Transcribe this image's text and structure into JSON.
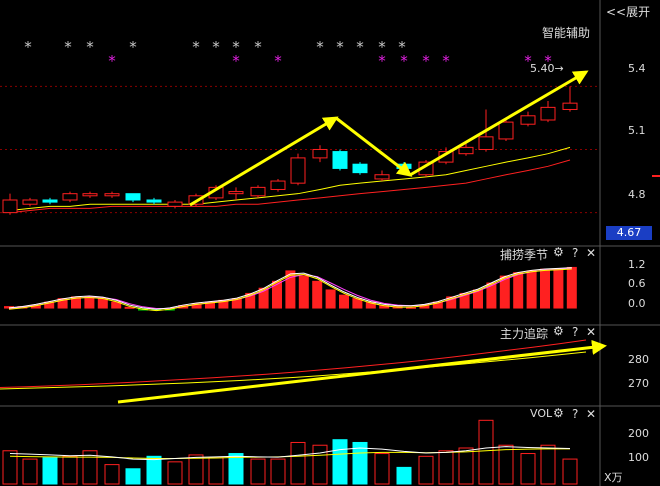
{
  "header": {
    "expand_label": "<<展开",
    "panel_title": "智能辅助"
  },
  "markers": {
    "gray_symbol": "*",
    "magenta_symbol": "*",
    "gray_x": [
      28,
      68,
      90,
      133,
      196,
      216,
      236,
      258,
      320,
      340,
      360,
      382,
      402
    ],
    "magenta_x": [
      112,
      236,
      278,
      382,
      404,
      426,
      446,
      528,
      548
    ]
  },
  "main": {
    "price_tag": "5.40→",
    "current_price": "4.67",
    "axis_labels": [
      "5.4",
      "5.1",
      "4.8"
    ],
    "ylim": [
      4.67,
      5.62
    ],
    "candles": [
      {
        "x": 10,
        "o": 4.86,
        "c": 4.8,
        "h": 4.89,
        "l": 4.79,
        "color": "red-hollow"
      },
      {
        "x": 30,
        "o": 4.84,
        "c": 4.86,
        "h": 4.87,
        "l": 4.83,
        "color": "red-hollow"
      },
      {
        "x": 50,
        "o": 4.85,
        "c": 4.86,
        "h": 4.87,
        "l": 4.84,
        "color": "cyan"
      },
      {
        "x": 70,
        "o": 4.86,
        "c": 4.89,
        "h": 4.9,
        "l": 4.85,
        "color": "red-hollow"
      },
      {
        "x": 90,
        "o": 4.88,
        "c": 4.89,
        "h": 4.9,
        "l": 4.87,
        "color": "red-hollow"
      },
      {
        "x": 112,
        "o": 4.89,
        "c": 4.88,
        "h": 4.9,
        "l": 4.87,
        "color": "red-hollow"
      },
      {
        "x": 133,
        "o": 4.89,
        "c": 4.86,
        "h": 4.89,
        "l": 4.85,
        "color": "cyan"
      },
      {
        "x": 154,
        "o": 4.86,
        "c": 4.85,
        "h": 4.87,
        "l": 4.84,
        "color": "cyan"
      },
      {
        "x": 175,
        "o": 4.83,
        "c": 4.85,
        "h": 4.86,
        "l": 4.82,
        "color": "red-hollow"
      },
      {
        "x": 196,
        "o": 4.84,
        "c": 4.88,
        "h": 4.89,
        "l": 4.83,
        "color": "red-hollow"
      },
      {
        "x": 216,
        "o": 4.87,
        "c": 4.92,
        "h": 4.93,
        "l": 4.86,
        "color": "red-hollow"
      },
      {
        "x": 236,
        "o": 4.9,
        "c": 4.89,
        "h": 4.92,
        "l": 4.86,
        "color": "red-hollow"
      },
      {
        "x": 258,
        "o": 4.88,
        "c": 4.92,
        "h": 4.93,
        "l": 4.87,
        "color": "red-hollow"
      },
      {
        "x": 278,
        "o": 4.91,
        "c": 4.95,
        "h": 4.96,
        "l": 4.9,
        "color": "red-hollow"
      },
      {
        "x": 298,
        "o": 4.94,
        "c": 5.06,
        "h": 5.08,
        "l": 4.93,
        "color": "red-hollow"
      },
      {
        "x": 320,
        "o": 5.06,
        "c": 5.1,
        "h": 5.12,
        "l": 5.04,
        "color": "red-hollow"
      },
      {
        "x": 340,
        "o": 5.09,
        "c": 5.01,
        "h": 5.1,
        "l": 5.0,
        "color": "cyan"
      },
      {
        "x": 360,
        "o": 5.03,
        "c": 4.99,
        "h": 5.04,
        "l": 4.98,
        "color": "cyan"
      },
      {
        "x": 382,
        "o": 4.98,
        "c": 4.96,
        "h": 5.0,
        "l": 4.95,
        "color": "red-hollow"
      },
      {
        "x": 404,
        "o": 5.03,
        "c": 5.01,
        "h": 5.04,
        "l": 5.0,
        "color": "cyan"
      },
      {
        "x": 426,
        "o": 4.98,
        "c": 5.04,
        "h": 5.05,
        "l": 4.97,
        "color": "red-hollow"
      },
      {
        "x": 446,
        "o": 5.04,
        "c": 5.09,
        "h": 5.11,
        "l": 5.03,
        "color": "red-hollow"
      },
      {
        "x": 466,
        "o": 5.08,
        "c": 5.11,
        "h": 5.13,
        "l": 5.07,
        "color": "red-hollow"
      },
      {
        "x": 486,
        "o": 5.1,
        "c": 5.16,
        "h": 5.29,
        "l": 5.09,
        "color": "red-hollow"
      },
      {
        "x": 506,
        "o": 5.15,
        "c": 5.23,
        "h": 5.25,
        "l": 5.14,
        "color": "red-hollow"
      },
      {
        "x": 528,
        "o": 5.22,
        "c": 5.26,
        "h": 5.28,
        "l": 5.21,
        "color": "red-hollow"
      },
      {
        "x": 548,
        "o": 5.24,
        "c": 5.3,
        "h": 5.33,
        "l": 5.23,
        "color": "red-hollow"
      },
      {
        "x": 570,
        "o": 5.29,
        "c": 5.32,
        "h": 5.4,
        "l": 5.28,
        "color": "red-hollow"
      }
    ],
    "ma_yellow": [
      4.81,
      4.82,
      4.83,
      4.83,
      4.84,
      4.84,
      4.84,
      4.84,
      4.84,
      4.84,
      4.85,
      4.86,
      4.87,
      4.88,
      4.89,
      4.91,
      4.93,
      4.94,
      4.95,
      4.96,
      4.97,
      4.98,
      5.0,
      5.02,
      5.04,
      5.06,
      5.08,
      5.11
    ],
    "ma_red": [
      4.8,
      4.81,
      4.82,
      4.82,
      4.82,
      4.83,
      4.83,
      4.83,
      4.83,
      4.83,
      4.83,
      4.84,
      4.84,
      4.85,
      4.86,
      4.87,
      4.88,
      4.89,
      4.9,
      4.91,
      4.92,
      4.93,
      4.94,
      4.96,
      4.98,
      5.0,
      5.02,
      5.05
    ],
    "arrows": [
      {
        "from": [
          190,
          205
        ],
        "to": [
          336,
          118
        ]
      },
      {
        "from": [
          336,
          118
        ],
        "to": [
          410,
          175
        ]
      },
      {
        "from": [
          410,
          175
        ],
        "to": [
          586,
          72
        ]
      }
    ]
  },
  "panel_bull": {
    "title": "捕捞季节",
    "axis_labels": [
      "1.2",
      "0.6",
      "0.0"
    ],
    "ylim": [
      -0.1,
      1.4
    ],
    "bars": [
      0.07,
      0.07,
      0.1,
      0.2,
      0.3,
      0.35,
      0.35,
      0.3,
      0.2,
      0.05,
      0.0,
      -0.05,
      0.0,
      0.1,
      0.15,
      0.2,
      0.25,
      0.3,
      0.45,
      0.6,
      0.8,
      1.1,
      0.95,
      0.8,
      0.55,
      0.4,
      0.3,
      0.2,
      0.1,
      0.07,
      0.05,
      0.1,
      0.2,
      0.35,
      0.45,
      0.55,
      0.75,
      0.95,
      1.05,
      1.1,
      1.15,
      1.15,
      1.2
    ],
    "line_a": [
      0.02,
      0.06,
      0.12,
      0.2,
      0.28,
      0.34,
      0.36,
      0.33,
      0.24,
      0.1,
      0.02,
      -0.02,
      0.02,
      0.1,
      0.16,
      0.2,
      0.24,
      0.3,
      0.42,
      0.58,
      0.8,
      1.0,
      1.02,
      0.9,
      0.68,
      0.48,
      0.32,
      0.2,
      0.12,
      0.08,
      0.08,
      0.12,
      0.2,
      0.32,
      0.44,
      0.56,
      0.74,
      0.92,
      1.04,
      1.1,
      1.14,
      1.16,
      1.18
    ],
    "line_b": [
      0.0,
      0.04,
      0.09,
      0.16,
      0.24,
      0.3,
      0.33,
      0.32,
      0.26,
      0.14,
      0.05,
      0.0,
      0.0,
      0.06,
      0.12,
      0.17,
      0.21,
      0.26,
      0.36,
      0.5,
      0.7,
      0.9,
      0.98,
      0.92,
      0.74,
      0.55,
      0.38,
      0.24,
      0.15,
      0.1,
      0.08,
      0.1,
      0.16,
      0.26,
      0.38,
      0.5,
      0.66,
      0.84,
      0.98,
      1.06,
      1.11,
      1.14,
      1.16
    ]
  },
  "panel_track": {
    "title": "主力追踪",
    "axis_labels": [
      "280",
      "270"
    ],
    "ylim": [
      264,
      292
    ],
    "line_red": [
      269.0,
      269.3,
      269.7,
      270.1,
      270.6,
      271.1,
      271.7,
      272.3,
      272.9,
      273.6,
      274.3,
      275.1,
      276.0,
      276.9,
      277.9,
      278.9,
      280.0,
      281.2,
      282.5,
      283.8,
      285.1,
      286.5,
      288.0
    ],
    "line_yellow": [
      268.4,
      268.7,
      269.0,
      269.3,
      269.6,
      270.0,
      270.4,
      270.8,
      271.3,
      271.8,
      272.4,
      273.0,
      273.7,
      274.5,
      275.3,
      276.2,
      277.1,
      278.0,
      279.0,
      280.0,
      281.0,
      282.1,
      283.2
    ],
    "arrow": {
      "from": [
        118,
        402
      ],
      "to": [
        604,
        346
      ]
    }
  },
  "panel_vol": {
    "title": "VOL",
    "axis_labels": [
      "200",
      "100"
    ],
    "unit": "X万",
    "ylim": [
      0,
      260
    ],
    "bars": [
      {
        "x": 10,
        "v": 120,
        "color": "red-hollow"
      },
      {
        "x": 30,
        "v": 90,
        "color": "red-hollow"
      },
      {
        "x": 50,
        "v": 95,
        "color": "cyan"
      },
      {
        "x": 70,
        "v": 100,
        "color": "red-hollow"
      },
      {
        "x": 90,
        "v": 120,
        "color": "red-hollow"
      },
      {
        "x": 112,
        "v": 70,
        "color": "red-hollow"
      },
      {
        "x": 133,
        "v": 55,
        "color": "cyan"
      },
      {
        "x": 154,
        "v": 100,
        "color": "cyan"
      },
      {
        "x": 175,
        "v": 80,
        "color": "red-hollow"
      },
      {
        "x": 196,
        "v": 105,
        "color": "red-hollow"
      },
      {
        "x": 216,
        "v": 95,
        "color": "red-hollow"
      },
      {
        "x": 236,
        "v": 110,
        "color": "cyan"
      },
      {
        "x": 258,
        "v": 90,
        "color": "red-hollow"
      },
      {
        "x": 278,
        "v": 90,
        "color": "red-hollow"
      },
      {
        "x": 298,
        "v": 150,
        "color": "red-hollow"
      },
      {
        "x": 320,
        "v": 140,
        "color": "red-hollow"
      },
      {
        "x": 340,
        "v": 160,
        "color": "cyan"
      },
      {
        "x": 360,
        "v": 150,
        "color": "cyan"
      },
      {
        "x": 382,
        "v": 110,
        "color": "red-hollow"
      },
      {
        "x": 404,
        "v": 60,
        "color": "cyan"
      },
      {
        "x": 426,
        "v": 100,
        "color": "red-hollow"
      },
      {
        "x": 446,
        "v": 120,
        "color": "red-hollow"
      },
      {
        "x": 466,
        "v": 130,
        "color": "red-hollow"
      },
      {
        "x": 486,
        "v": 230,
        "color": "red-hollow"
      },
      {
        "x": 506,
        "v": 140,
        "color": "red-hollow"
      },
      {
        "x": 528,
        "v": 110,
        "color": "red-hollow"
      },
      {
        "x": 548,
        "v": 140,
        "color": "red-hollow"
      },
      {
        "x": 570,
        "v": 90,
        "color": "red-hollow"
      }
    ],
    "ma_a": [
      110,
      108,
      105,
      102,
      104,
      98,
      90,
      88,
      92,
      96,
      98,
      100,
      98,
      97,
      104,
      112,
      124,
      130,
      126,
      118,
      112,
      114,
      120,
      130,
      135,
      132,
      130,
      128
    ],
    "ma_b": [
      100,
      99,
      98,
      97,
      97,
      96,
      94,
      92,
      92,
      93,
      94,
      96,
      97,
      98,
      100,
      104,
      108,
      112,
      114,
      114,
      113,
      114,
      116,
      120,
      124,
      126,
      127,
      127
    ]
  },
  "controls": {
    "gear": "⚙",
    "help": "?",
    "close": "✕"
  },
  "colors": {
    "red": "#ff2020",
    "cyan": "#00ffff",
    "yellow": "#ffff00",
    "magenta": "#e020e0",
    "green": "#00cc00",
    "grid": "#8a0000",
    "gray_marker": "#c8c8c8",
    "price_box": "#1a3ec4"
  }
}
